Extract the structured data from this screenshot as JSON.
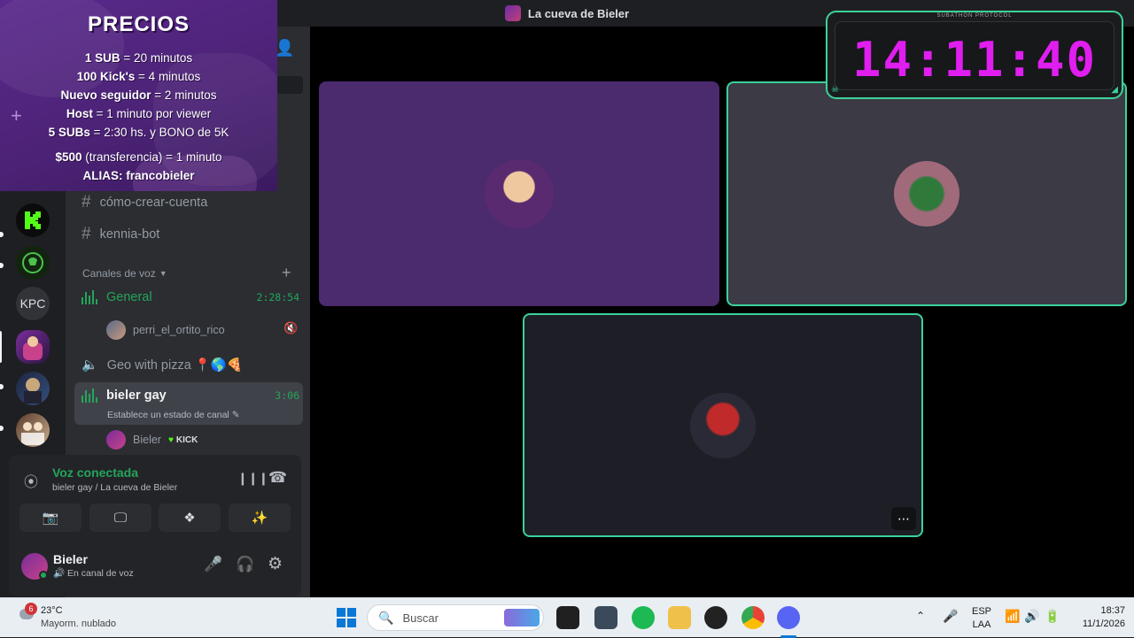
{
  "window": {
    "title": "La cueva de Bieler"
  },
  "overlay": {
    "title": "PRECIOS",
    "lines": [
      {
        "bold": "1 SUB",
        "rest": " = 20 minutos"
      },
      {
        "bold": "100 Kick's",
        "rest": " = 4 minutos"
      },
      {
        "bold": "Nuevo seguidor",
        "rest": " = 2 minutos"
      },
      {
        "bold": "Host",
        "rest": " = 1 minuto por viewer"
      },
      {
        "bold": "5 SUBs",
        "rest": " = 2:30 hs. y BONO de 5K"
      },
      {
        "bold": "$500",
        "rest": " (transferencia) = 1 minuto"
      },
      {
        "bold": "ALIAS: francobieler",
        "rest": ""
      }
    ]
  },
  "servers": [
    {
      "name": "kick-server",
      "color": "#53fc18"
    },
    {
      "name": "green-skull-server",
      "color": "#1f3b1f"
    },
    {
      "name": "KPC",
      "color": "#313338"
    },
    {
      "name": "cueva-server",
      "color": "#4a2a6a"
    },
    {
      "name": "purple-server",
      "color": "#2a3550"
    },
    {
      "name": "people-server",
      "color": "#3a2a2a"
    }
  ],
  "kpc_label": "KPC",
  "channels": {
    "text": [
      {
        "label": "cómo-crear-cuenta"
      },
      {
        "label": "kennia-bot"
      }
    ],
    "voice_category": "Canales de voz",
    "voice": [
      {
        "label": "General",
        "time": "2:28:54",
        "user": "perri_el_ortito_rico"
      },
      {
        "label": "Geo with pizza 📍🌎🍕"
      },
      {
        "label": "bieler gay",
        "time": "3:06",
        "status": "Establece un estado de canal",
        "user": "Bieler",
        "badge": "KICK"
      }
    ]
  },
  "voice_panel": {
    "title": "Voz conectada",
    "subtitle": "bieler gay / La cueva de Bieler"
  },
  "user_panel": {
    "name": "Bieler",
    "status": "En canal de voz"
  },
  "timer": {
    "digits": "14:11:40",
    "label": "SUBATHON PROTOCOL"
  },
  "taskbar": {
    "weather_temp": "23°C",
    "weather_desc": "Mayorm. nublado",
    "weather_badge": "6",
    "search_placeholder": "Buscar",
    "lang": "ESP",
    "lang_sub": "LAA",
    "time": "18:37",
    "date": "11/1/2026"
  },
  "colors": {
    "accent": "#23a55a",
    "timer": "#e01ef0",
    "tile_border": "#3ad29a"
  }
}
